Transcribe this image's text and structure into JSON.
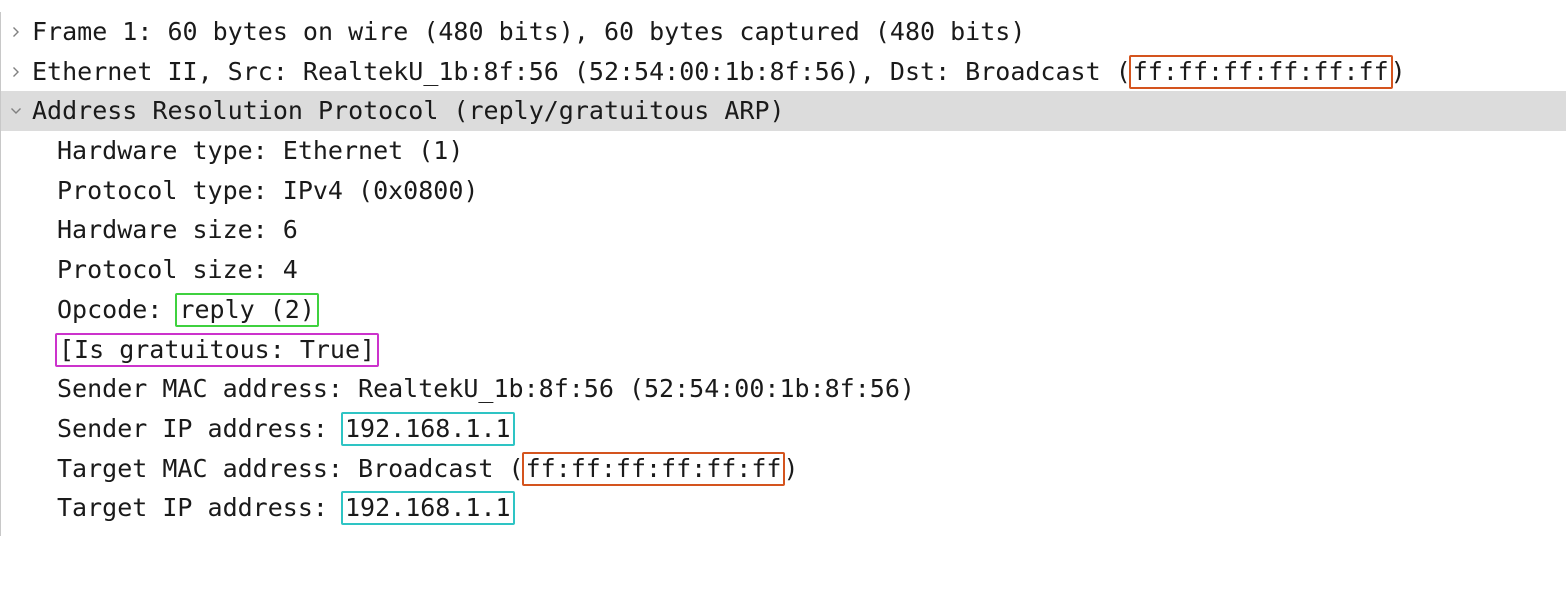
{
  "colors": {
    "mac_highlight": "#d4541e",
    "opcode_highlight": "#3fd13f",
    "gratuitous_highlight": "#cc33cc",
    "ip_highlight": "#2ec4c4",
    "selected_row": "#dcdcdc"
  },
  "tree": {
    "frame": {
      "text": "Frame 1: 60 bytes on wire (480 bits), 60 bytes captured (480 bits)",
      "icon": "chevron-right-icon"
    },
    "ethernet": {
      "prefix": "Ethernet II, Src: RealtekU_1b:8f:56 (52:54:00:1b:8f:56), Dst: Broadcast (",
      "dst_mac": "ff:ff:ff:ff:ff:ff",
      "suffix": ")",
      "icon": "chevron-right-icon"
    },
    "arp": {
      "text": "Address Resolution Protocol (reply/gratuitous ARP)",
      "icon": "chevron-down-icon",
      "fields": {
        "hardware_type": "Hardware type: Ethernet (1)",
        "protocol_type": "Protocol type: IPv4 (0x0800)",
        "hardware_size": "Hardware size: 6",
        "protocol_size": "Protocol size: 4",
        "opcode_label": "Opcode: ",
        "opcode_value": "reply (2)",
        "is_gratuitous": "[Is gratuitous: True]",
        "sender_mac": "Sender MAC address: RealtekU_1b:8f:56 (52:54:00:1b:8f:56)",
        "sender_ip_label": "Sender IP address: ",
        "sender_ip_value": "192.168.1.1",
        "target_mac_prefix": "Target MAC address: Broadcast (",
        "target_mac_value": "ff:ff:ff:ff:ff:ff",
        "target_mac_suffix": ")",
        "target_ip_label": "Target IP address: ",
        "target_ip_value": "192.168.1.1"
      }
    }
  }
}
